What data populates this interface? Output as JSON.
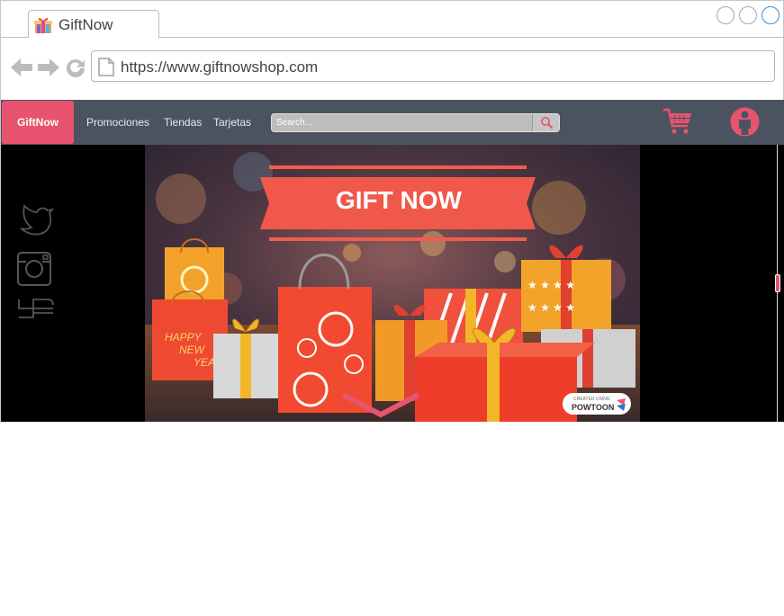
{
  "browser": {
    "tab_title": "GiftNow",
    "url": "https://www.giftnowshop.com"
  },
  "navbar": {
    "brand": "GiftNow",
    "links": [
      "Promociones",
      "Tiendas",
      "Tarjetas"
    ],
    "search_placeholder": "Search..."
  },
  "hero": {
    "banner_text": "GIFT NOW",
    "bag_text": [
      "HAPPY",
      "NEW",
      "YEAR"
    ],
    "watermark_small": "CREATED USING",
    "watermark_brand": "POWTOON"
  },
  "colors": {
    "accent": "#e8546f",
    "navbar": "#4c5360",
    "banner": "#f0584c"
  },
  "icons": {
    "back": "back-arrow-icon",
    "forward": "forward-arrow-icon",
    "reload": "reload-icon",
    "cart": "shopping-cart-icon",
    "user": "user-icon",
    "social": [
      "twitter-icon",
      "instagram-icon",
      "facebook-icon"
    ]
  }
}
